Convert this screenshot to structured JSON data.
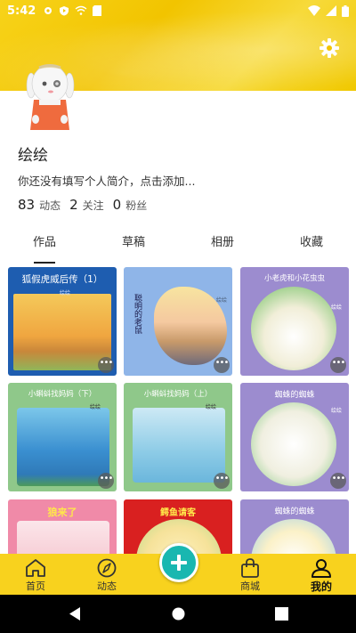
{
  "status_bar": {
    "time": "5:42"
  },
  "profile": {
    "username": "绘绘",
    "bio": "你还没有填写个人简介，点击添加...",
    "stats": [
      {
        "value": "83",
        "label": "动态"
      },
      {
        "value": "2",
        "label": "关注"
      },
      {
        "value": "0",
        "label": "粉丝"
      }
    ]
  },
  "tabs": [
    {
      "label": "作品",
      "active": true
    },
    {
      "label": "草稿",
      "active": false
    },
    {
      "label": "相册",
      "active": false
    },
    {
      "label": "收藏",
      "active": false
    }
  ],
  "works": [
    {
      "title": "狐假虎威后传（1）",
      "author": "绘绘",
      "bg": "#1e5db0",
      "title_color": "#ffffff"
    },
    {
      "title": "聪明的老鼠",
      "author": "绘绘",
      "bg": "#8fb5e8",
      "title_color": "#1a1a4a"
    },
    {
      "title": "小老虎和小花虫虫",
      "author": "绘绘",
      "bg": "#9c8ccf",
      "title_color": "#ffffff"
    },
    {
      "title": "小蝌蚪找妈妈（下）",
      "author": "绘绘",
      "bg": "#8fc88a",
      "title_color": "#ffffff"
    },
    {
      "title": "小蝌蚪找妈妈（上）",
      "author": "绘绘",
      "bg": "#8fc88a",
      "title_color": "#ffffff"
    },
    {
      "title": "蜘蛛的蜘蛛",
      "author": "绘绘",
      "bg": "#9c8ccf",
      "title_color": "#ffffff"
    },
    {
      "title": "狼来了",
      "author": "",
      "bg": "#f08aa8",
      "title_color": "#ffe84a"
    },
    {
      "title": "鳄鱼请客",
      "author": "",
      "bg": "#d92020",
      "title_color": "#ffe84a"
    },
    {
      "title": "蜘蛛的蜘蛛",
      "author": "",
      "bg": "#9c8ccf",
      "title_color": "#ffffff"
    }
  ],
  "more_label": "•••",
  "bottom_nav": [
    {
      "label": "首页",
      "icon": "home-icon"
    },
    {
      "label": "动态",
      "icon": "compass-icon"
    },
    {
      "label": "商城",
      "icon": "shopping-bag-icon"
    },
    {
      "label": "我的",
      "icon": "person-icon",
      "active": true
    }
  ],
  "colors": {
    "accent": "#f8d21e",
    "fab": "#19b7b0"
  }
}
